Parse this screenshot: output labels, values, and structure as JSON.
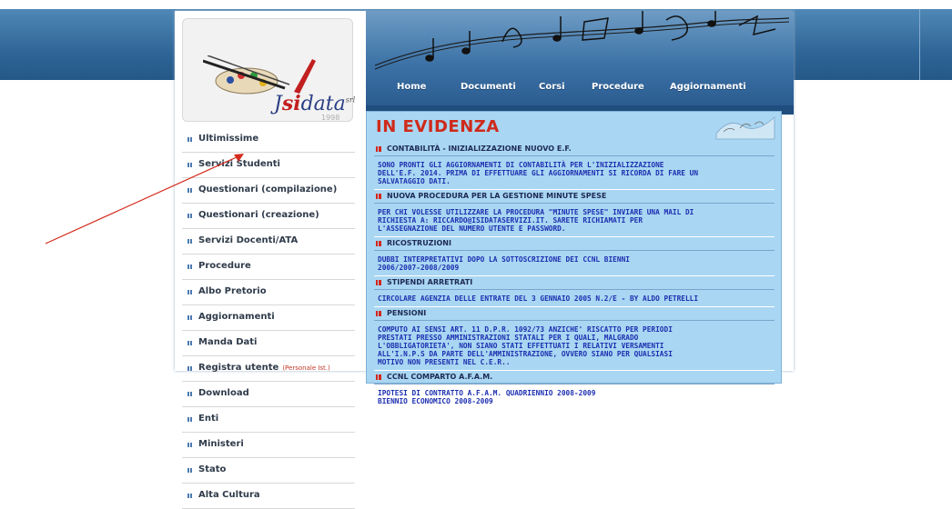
{
  "brand": {
    "logo_text_pre": "",
    "logo_text_accent": "si",
    "logo_text_prefix": "J",
    "logo_text_post": "data",
    "logo_suffix": "srl",
    "logo_sub": "1998"
  },
  "nav": {
    "items": [
      "Home",
      "Documenti",
      "Corsi",
      "Procedure",
      "Aggiornamenti"
    ]
  },
  "menu": {
    "items": [
      {
        "label": "Ultimissime"
      },
      {
        "label": "Servizi Studenti"
      },
      {
        "label": "Questionari (compilazione)"
      },
      {
        "label": "Questionari (creazione)"
      },
      {
        "label": "Servizi Docenti/ATA"
      },
      {
        "label": "Procedure"
      },
      {
        "label": "Albo Pretorio"
      },
      {
        "label": "Aggiornamenti"
      },
      {
        "label": "Manda Dati"
      },
      {
        "label": "Registra utente",
        "note": "(Personale Ist.)"
      },
      {
        "label": "Download"
      },
      {
        "label": "Enti"
      },
      {
        "label": "Ministeri"
      },
      {
        "label": "Stato"
      },
      {
        "label": "Alta Cultura"
      }
    ]
  },
  "content": {
    "title": "IN EVIDENZA",
    "news": [
      {
        "heading": "CONTABILITÀ - INIZIALIZZAZIONE NUOVO E.F.",
        "body": "SONO PRONTI GLI AGGIORNAMENTI DI CONTABILITÀ PER L'INIZIALIZZAZIONE\nDELL'E.F. 2014. PRIMA DI EFFETTUARE GLI AGGIORNAMENTI SI RICORDA DI FARE UN\nSALVATAGGIO DATI."
      },
      {
        "heading": "NUOVA PROCEDURA PER LA GESTIONE MINUTE SPESE",
        "body": "PER CHI VOLESSE UTILIZZARE LA PROCEDURA \"MINUTE SPESE\" INVIARE UNA MAIL DI\nRICHIESTA A: RICCARDO@ISIDATASERVIZI.IT. SARETE RICHIAMATI PER\nL'ASSEGNAZIONE DEL NUMERO UTENTE E PASSWORD."
      },
      {
        "heading": "RICOSTRUZIONI",
        "body": "DUBBI INTERPRETATIVI DOPO LA SOTTOSCRIZIONE DEI CCNL BIENNI\n2006/2007-2008/2009"
      },
      {
        "heading": "STIPENDI ARRETRATI",
        "body": "CIRCOLARE AGENZIA DELLE ENTRATE DEL 3 GENNAIO 2005 N.2/E - BY ALDO PETRELLI"
      },
      {
        "heading": "PENSIONI",
        "body": "COMPUTO AI SENSI ART. 11 D.P.R. 1092/73 ANZICHE' RISCATTO PER PERIODI\nPRESTATI PRESSO AMMINISTRAZIONI STATALI PER I QUALI, MALGRADO\nL'OBBLIGATORIETA', NON SIANO STATI EFFETTUATI I RELATIVI VERSAMENTI\nALL'I.N.P.S DA PARTE DELL'AMMINISTRAZIONE, OVVERO SIANO PER QUALSIASI\nMOTIVO NON PRESENTI NEL C.E.R.."
      },
      {
        "heading": "CCNL COMPARTO A.F.A.M.",
        "body": "IPOTESI DI CONTRATTO A.F.A.M. QUADRIENNIO 2008-2009\nBIENNIO ECONOMICO 2008-2009"
      }
    ]
  },
  "colors": {
    "accent_red": "#cf2a1b",
    "link_blue": "#1c2fb0",
    "header_blue": "#2f6698",
    "panel_blue": "#a9d6f2"
  }
}
